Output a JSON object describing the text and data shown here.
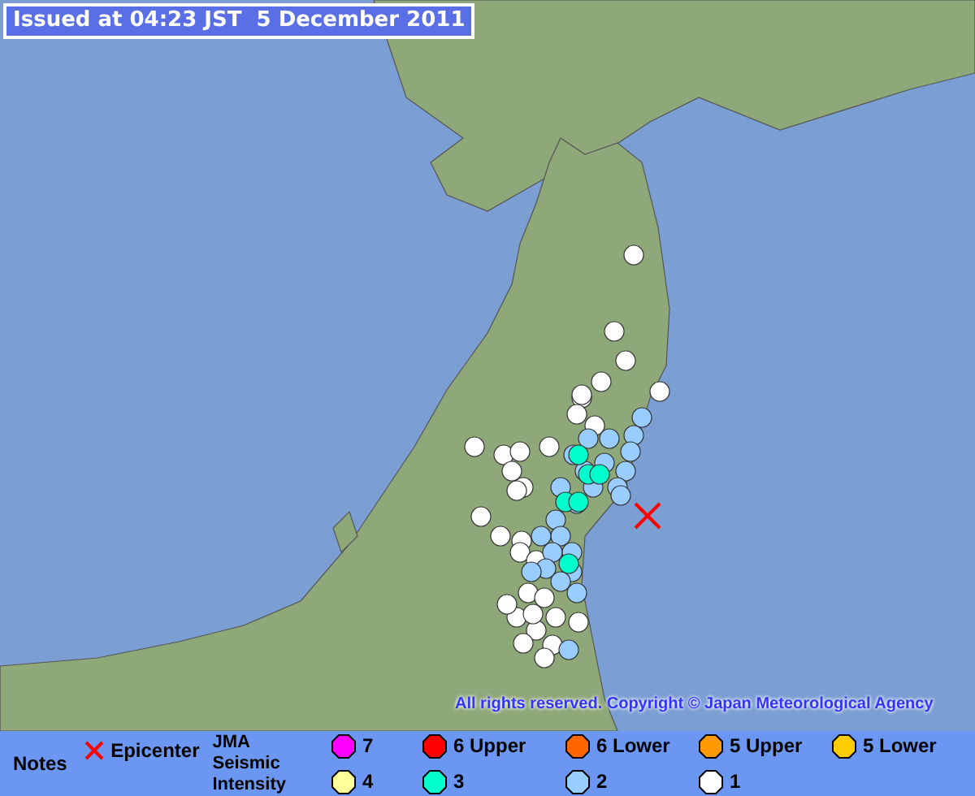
{
  "issued": "Issued at 04:23 JST  5 December 2011",
  "copyright": "All rights reserved. Copyright © Japan Meteorological Agency",
  "legend": {
    "notes": "Notes",
    "epicenter": "Epicenter",
    "intensity_label": "JMA Seismic Intensity",
    "levels": [
      {
        "label": "7",
        "color": "#ff00ff"
      },
      {
        "label": "6 Upper",
        "color": "#ff0000"
      },
      {
        "label": "6 Lower",
        "color": "#ff6600"
      },
      {
        "label": "5 Upper",
        "color": "#ff9900"
      },
      {
        "label": "5 Lower",
        "color": "#ffcc00"
      },
      {
        "label": "4",
        "color": "#ffff99"
      },
      {
        "label": "3",
        "color": "#00ffcc"
      },
      {
        "label": "2",
        "color": "#99ccff"
      },
      {
        "label": "1",
        "color": "#ffffff"
      }
    ]
  }
}
